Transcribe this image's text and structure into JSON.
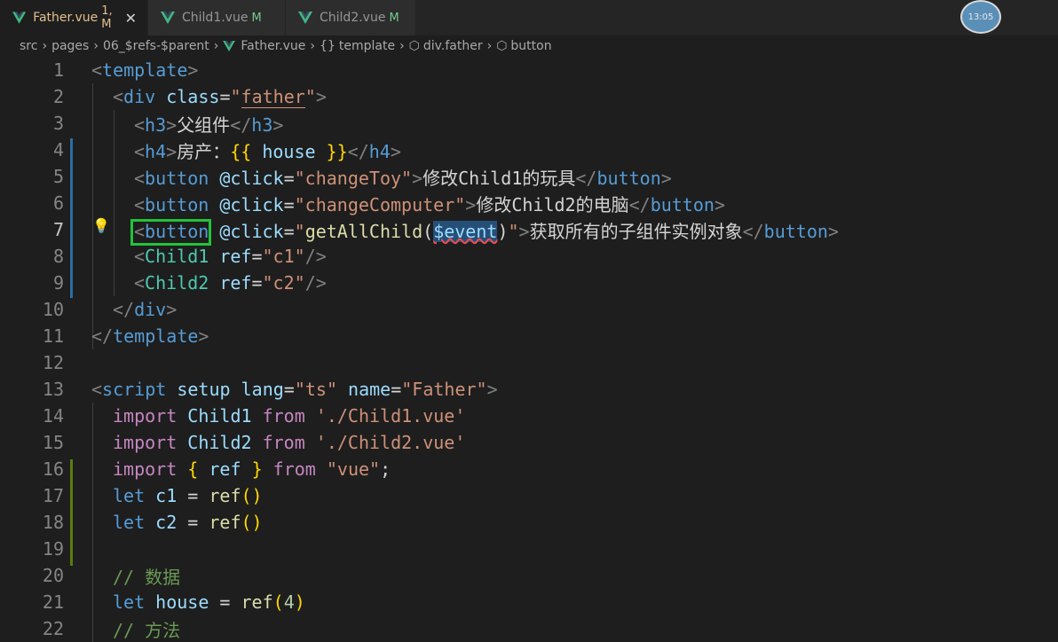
{
  "tabs": [
    {
      "label": "Father.vue",
      "status": "1, M",
      "active": true
    },
    {
      "label": "Child1.vue",
      "status": "M",
      "active": false
    },
    {
      "label": "Child2.vue",
      "status": "M",
      "active": false
    }
  ],
  "close_glyph": "✕",
  "avatar_text": "13:05",
  "breadcrumb": [
    "src",
    "pages",
    "06_$refs-$parent",
    "Father.vue",
    "template",
    "div.father",
    "button"
  ],
  "line_numbers": [
    "1",
    "2",
    "3",
    "4",
    "5",
    "6",
    "7",
    "8",
    "9",
    "10",
    "11",
    "12",
    "13",
    "14",
    "15",
    "16",
    "17",
    "18",
    "19",
    "20",
    "21",
    "22"
  ],
  "code": {
    "l1": [
      "<",
      "template",
      ">"
    ],
    "l2": [
      "<",
      "div",
      " ",
      "class",
      "=",
      "\"",
      "father",
      "\"",
      ">"
    ],
    "l3": [
      "<",
      "h3",
      ">",
      "父组件",
      "</",
      "h3",
      ">"
    ],
    "l4": [
      "<",
      "h4",
      ">",
      "房产：",
      "{{",
      " house ",
      "}}",
      "</",
      "h4",
      ">"
    ],
    "l5": [
      "<",
      "button",
      " ",
      "@click",
      "=",
      "\"changeToy\"",
      ">",
      "修改Child1的玩具",
      "</",
      "button",
      ">"
    ],
    "l6": [
      "<",
      "button",
      " ",
      "@click",
      "=",
      "\"changeComputer\"",
      ">",
      "修改Child2的电脑",
      "</",
      "button",
      ">"
    ],
    "l7": [
      "<",
      "button",
      " ",
      "@click",
      "=",
      "\"",
      "getAllChild",
      "(",
      "$event",
      ")",
      "\"",
      ">",
      "获取所有的子组件实例对象",
      "</",
      "button",
      ">"
    ],
    "l8": [
      "<",
      "Child1",
      " ",
      "ref",
      "=",
      "\"c1\"",
      "/>"
    ],
    "l9": [
      "<",
      "Child2",
      " ",
      "ref",
      "=",
      "\"c2\"",
      "/>"
    ],
    "l10": [
      "</",
      "div",
      ">"
    ],
    "l11": [
      "</",
      "template",
      ">"
    ],
    "l13": [
      "<",
      "script",
      " ",
      "setup",
      " ",
      "lang",
      "=",
      "\"ts\"",
      " ",
      "name",
      "=",
      "\"Father\"",
      ">"
    ],
    "l14": [
      "import",
      " Child1 ",
      "from",
      " ",
      "'./Child1.vue'"
    ],
    "l15": [
      "import",
      " Child2 ",
      "from",
      " ",
      "'./Child2.vue'"
    ],
    "l16": [
      "import",
      " ",
      "{",
      " ",
      "ref",
      " ",
      "}",
      " ",
      "from",
      " ",
      "\"vue\"",
      ";"
    ],
    "l17": [
      "let",
      " ",
      "c1",
      " = ",
      "ref",
      "()"
    ],
    "l18": [
      "let",
      " ",
      "c2",
      " = ",
      "ref",
      "()"
    ],
    "l20": [
      "// 数据"
    ],
    "l21": [
      "let",
      " ",
      "house",
      " = ",
      "ref",
      "(",
      "4",
      ")"
    ],
    "l22": [
      "// 方法"
    ]
  }
}
